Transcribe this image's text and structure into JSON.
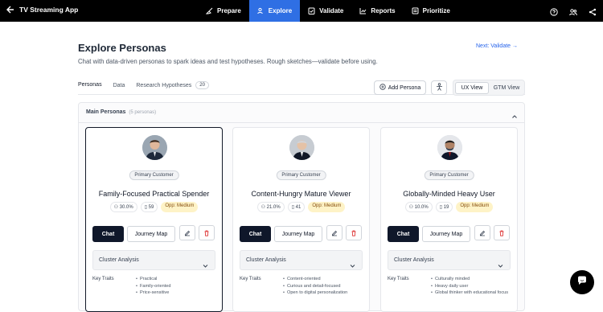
{
  "app": {
    "title": "TV Streaming App"
  },
  "nav": [
    {
      "label": "Prepare",
      "active": false
    },
    {
      "label": "Explore",
      "active": true
    },
    {
      "label": "Validate",
      "active": false
    },
    {
      "label": "Reports",
      "active": false
    },
    {
      "label": "Prioritize",
      "active": false
    }
  ],
  "header": {
    "title": "Explore Personas",
    "subtitle": "Chat with data-driven personas to spark ideas and test hypotheses. Rough sketches—validate before using.",
    "next_link": "Next: Validate →"
  },
  "tabs": [
    {
      "label": "Personas",
      "active": true
    },
    {
      "label": "Data",
      "active": false
    },
    {
      "label": "Research Hypotheses",
      "count": "20",
      "active": false
    }
  ],
  "toolbar": {
    "add_persona": "Add Persona",
    "view_options": [
      {
        "label": "UX View",
        "active": true
      },
      {
        "label": "GTM View",
        "active": false
      }
    ]
  },
  "section": {
    "title": "Main Personas",
    "count_text": "(5 personas)"
  },
  "personas": [
    {
      "badge": "Primary Customer",
      "name": "Family-Focused Practical Spender",
      "percent": "30.0%",
      "sources": "59",
      "opp": "Opp: Medium",
      "chat": "Chat",
      "journey": "Journey Map",
      "cluster": "Cluster Analysis",
      "traits_label": "Key Traits",
      "traits": [
        "Practical",
        "Family-oriented",
        "Price-sensitive"
      ]
    },
    {
      "badge": "Primary Customer",
      "name": "Content-Hungry Mature Viewer",
      "percent": "21.0%",
      "sources": "41",
      "opp": "Opp: Medium",
      "chat": "Chat",
      "journey": "Journey Map",
      "cluster": "Cluster Analysis",
      "traits_label": "Key Traits",
      "traits": [
        "Content-oriented",
        "Curious and detail-focused",
        "Open to digital personalization"
      ]
    },
    {
      "badge": "Primary Customer",
      "name": "Globally-Minded Heavy User",
      "percent": "10.0%",
      "sources": "19",
      "opp": "Opp: Medium",
      "chat": "Chat",
      "journey": "Journey Map",
      "cluster": "Cluster Analysis",
      "traits_label": "Key Traits",
      "traits": [
        "Culturally minded",
        "Heavy daily user",
        "Global thinker with educational focus"
      ]
    }
  ]
}
